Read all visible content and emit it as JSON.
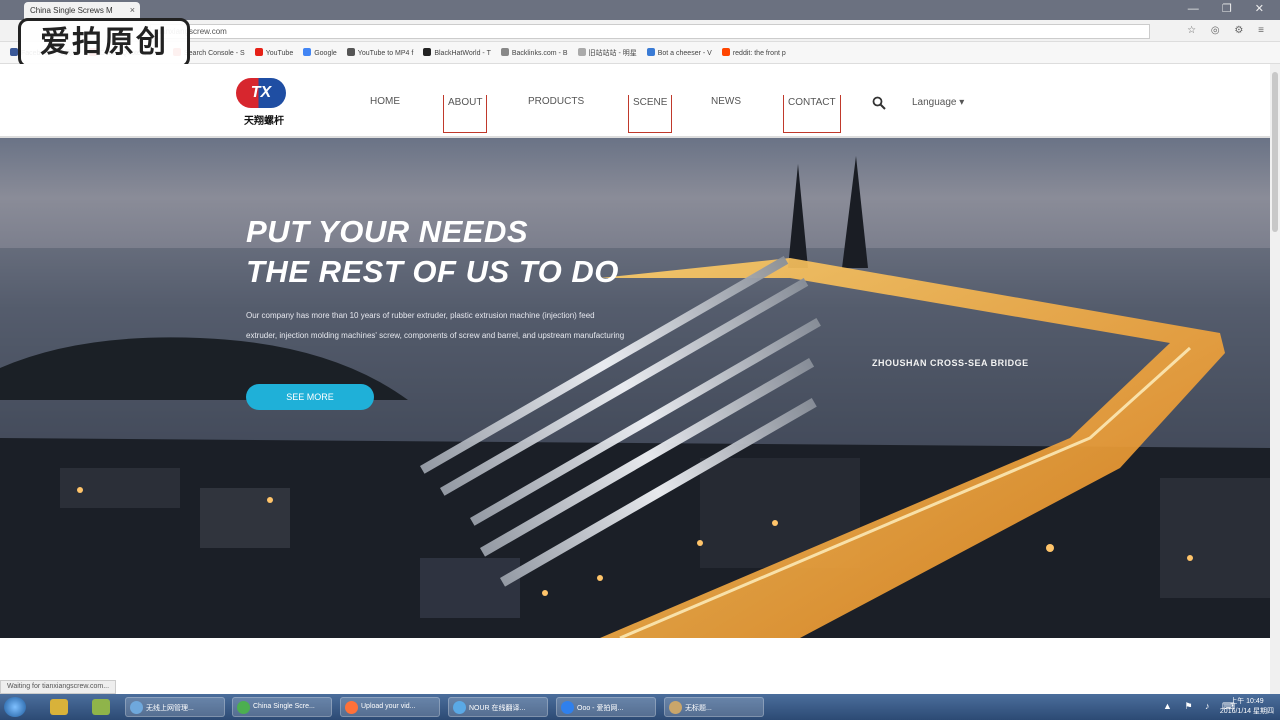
{
  "browser": {
    "tab_title": "China Single Screws M",
    "tab_close": "×",
    "url": "tianxiangscrew.com",
    "window_buttons": "— ❐ ✕",
    "ext_icons": "☆ ◎ ⚙ ≡"
  },
  "bookmarks": [
    {
      "label": "Facebook - 没网络",
      "color": "#3b5998"
    },
    {
      "label": "Deals, Quotes, Co...",
      "color": "#d0312d"
    },
    {
      "label": "Search Console - S",
      "color": "#e04a3f"
    },
    {
      "label": "YouTube",
      "color": "#e62117"
    },
    {
      "label": "Google",
      "color": "#4285f4"
    },
    {
      "label": "YouTube to MP4 f",
      "color": "#555555"
    },
    {
      "label": "BlackHatWorld - T",
      "color": "#222222"
    },
    {
      "label": "Backlinks.com - B",
      "color": "#888888"
    },
    {
      "label": "旧站站站 - 明星",
      "color": "#aaaaaa"
    },
    {
      "label": "Bot a cheeser - V",
      "color": "#3a7bd5"
    },
    {
      "label": "reddit: the front p",
      "color": "#ff4500"
    }
  ],
  "watermark": "爱拍原创",
  "site": {
    "logo_mark": "TX",
    "logo_text": "天翔螺杆",
    "nav": {
      "home": "HOME",
      "about": "ABOUT",
      "products": "PRODUCTS",
      "scene": "SCENE",
      "news": "NEWS",
      "contact": "CONTACT"
    },
    "language": "Language ▾"
  },
  "hero": {
    "title_line1": "PUT YOUR NEEDS",
    "title_line2": "THE REST OF US TO DO",
    "description": "Our company has more than 10 years of rubber extruder, plastic extrusion machine (injection) feed extruder, injection molding machines' screw, components of screw and barrel, and upstream manufacturing",
    "see_more": "SEE MORE",
    "bridge_label": "ZHOUSHAN CROSS-SEA BRIDGE"
  },
  "status_text": "Waiting for tianxiangscrew.com...",
  "taskbar": {
    "items": [
      {
        "label": "无线上网管理...",
        "color": "#6fa8dc"
      },
      {
        "label": "China Single Scre...",
        "color": "#4caf50"
      },
      {
        "label": "Upload your vid...",
        "color": "#ff7139"
      },
      {
        "label": "NOUR 在线翻译...",
        "color": "#5aa9e6"
      },
      {
        "label": "Ooo - 爱拍网...",
        "color": "#2f80ed"
      },
      {
        "label": "无标题...",
        "color": "#c9a66b"
      }
    ],
    "tray": "▲ ⚑ ♪ ⌨",
    "time": "上午 10:49",
    "date": "2016/1/14 星期四"
  }
}
